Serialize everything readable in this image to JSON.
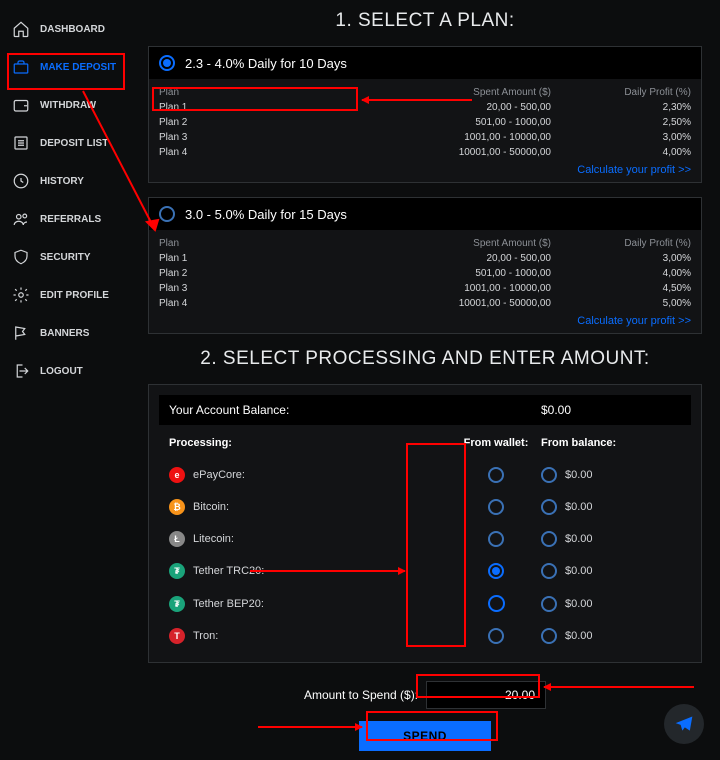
{
  "sidebar": {
    "items": [
      {
        "label": "DASHBOARD"
      },
      {
        "label": "MAKE DEPOSIT"
      },
      {
        "label": "WITHDRAW"
      },
      {
        "label": "DEPOSIT LIST"
      },
      {
        "label": "HISTORY"
      },
      {
        "label": "REFERRALS"
      },
      {
        "label": "SECURITY"
      },
      {
        "label": "EDIT PROFILE"
      },
      {
        "label": "BANNERS"
      },
      {
        "label": "LOGOUT"
      }
    ]
  },
  "steps": {
    "one": "1. SELECT A PLAN:",
    "two": "2. SELECT PROCESSING AND ENTER AMOUNT:"
  },
  "plans": {
    "cols": {
      "plan": "Plan",
      "spent": "Spent Amount ($)",
      "daily": "Daily Profit (%)"
    },
    "calc_label": "Calculate your profit >>",
    "a": {
      "title": "2.3 - 4.0% Daily for 10 Days",
      "rows": [
        {
          "plan": "Plan 1",
          "spent": "20,00 - 500,00",
          "daily": "2,30%"
        },
        {
          "plan": "Plan 2",
          "spent": "501,00 - 1000,00",
          "daily": "2,50%"
        },
        {
          "plan": "Plan 3",
          "spent": "1001,00 - 10000,00",
          "daily": "3,00%"
        },
        {
          "plan": "Plan 4",
          "spent": "10001,00 - 50000,00",
          "daily": "4,00%"
        }
      ]
    },
    "b": {
      "title": "3.0 - 5.0% Daily for 15 Days",
      "rows": [
        {
          "plan": "Plan 1",
          "spent": "20,00 - 500,00",
          "daily": "3,00%"
        },
        {
          "plan": "Plan 2",
          "spent": "501,00 - 1000,00",
          "daily": "4,00%"
        },
        {
          "plan": "Plan 3",
          "spent": "1001,00 - 10000,00",
          "daily": "4,50%"
        },
        {
          "plan": "Plan 4",
          "spent": "10001,00 - 50000,00",
          "daily": "5,00%"
        }
      ]
    }
  },
  "panel": {
    "balance_label": "Your Account Balance:",
    "balance_value": "$0.00",
    "head": {
      "processing": "Processing:",
      "wallet": "From wallet:",
      "balance": "From balance:"
    },
    "rows": [
      {
        "name": "ePayCore:",
        "color": "#e11",
        "glyph": "e",
        "balance": "$0.00"
      },
      {
        "name": "Bitcoin:",
        "color": "#f7931a",
        "glyph": "₿",
        "balance": "$0.00"
      },
      {
        "name": "Litecoin:",
        "color": "#888",
        "glyph": "Ł",
        "balance": "$0.00"
      },
      {
        "name": "Tether TRC20:",
        "color": "#1aa37a",
        "glyph": "₮",
        "balance": "$0.00"
      },
      {
        "name": "Tether BEP20:",
        "color": "#1aa37a",
        "glyph": "₮",
        "balance": "$0.00"
      },
      {
        "name": "Tron:",
        "color": "#d6222a",
        "glyph": "T",
        "balance": "$0.00"
      }
    ]
  },
  "amount": {
    "label": "Amount to Spend ($):",
    "value": "20.00"
  },
  "buttons": {
    "spend": "SPEND"
  },
  "colors": {
    "accent": "#0a6dff",
    "anno": "#ff0000"
  }
}
